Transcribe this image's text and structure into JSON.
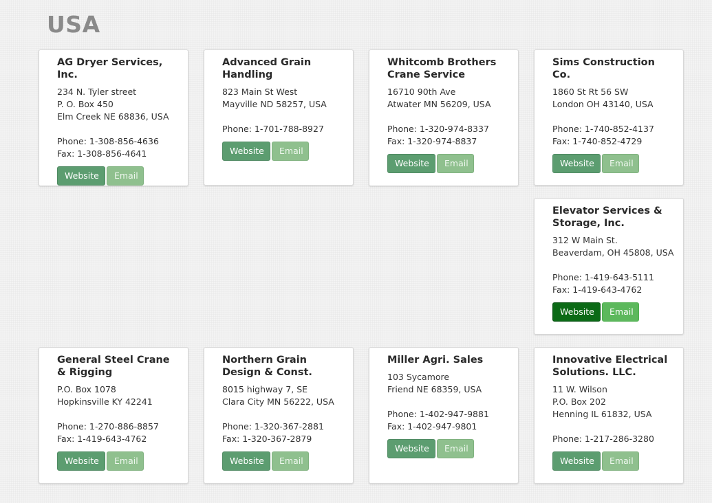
{
  "page": {
    "title": "USA"
  },
  "buttons": {
    "website": "Website",
    "email": "Email"
  },
  "dealers": [
    {
      "name": "AG Dryer Services, Inc.",
      "address": [
        "234 N. Tyler street",
        "P. O. Box 450",
        "Elm Creek NE 68836, USA"
      ],
      "contact": [
        "Phone: 1-308-856-4636",
        "Fax: 1-308-856-4641"
      ]
    },
    {
      "name": "Advanced Grain Handling",
      "address": [
        "823 Main St West",
        "Mayville ND 58257, USA"
      ],
      "contact": [
        "Phone: 1-701-788-8927"
      ]
    },
    {
      "name": "Whitcomb Brothers Crane Service",
      "address": [
        "16710 90th Ave",
        "Atwater MN 56209, USA"
      ],
      "contact": [
        "Phone: 1-320-974-8337",
        "Fax: 1-320-974-8837"
      ]
    },
    {
      "name": "Sims Construction Co.",
      "address": [
        "1860 St Rt 56 SW",
        "London OH 43140, USA"
      ],
      "contact": [
        "Phone: 1-740-852-4137",
        "Fax: 1-740-852-4729"
      ]
    },
    {
      "name": "Elevator Services & Storage, Inc.",
      "address": [
        "312 W Main St.",
        "Beaverdam, OH 45808, USA"
      ],
      "contact": [
        "Phone: 1-419-643-5111",
        "Fax: 1-419-643-4762"
      ]
    },
    {
      "name": "General Steel Crane & Rigging",
      "address": [
        "P.O. Box 1078",
        "Hopkinsville KY 42241"
      ],
      "contact": [
        "Phone: 1-270-886-8857",
        "Fax: 1-419-643-4762"
      ]
    },
    {
      "name": "Northern Grain Design & Const.",
      "address": [
        "8015 highway 7, SE",
        "Clara City MN 56222, USA"
      ],
      "contact": [
        "Phone: 1-320-367-2881",
        "Fax: 1-320-367-2879"
      ]
    },
    {
      "name": "Miller Agri. Sales",
      "address": [
        "103 Sycamore",
        "Friend NE 68359, USA"
      ],
      "contact": [
        "Phone: 1-402-947-9881",
        "Fax: 1-402-947-9801"
      ]
    },
    {
      "name": "Innovative Electrical Solutions. LLC.",
      "address": [
        "11 W. Wilson",
        "P.O. Box 202",
        "Henning IL 61832, USA"
      ],
      "contact": [
        "Phone: 1-217-286-3280"
      ]
    }
  ]
}
